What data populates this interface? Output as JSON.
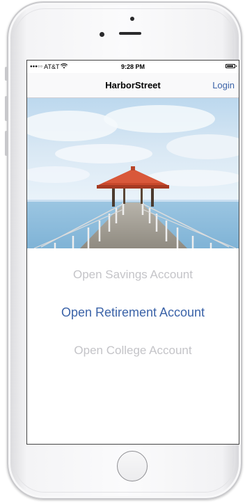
{
  "status_bar": {
    "signal": "●●●○○",
    "carrier": "AT&T",
    "time": "9:28 PM"
  },
  "nav": {
    "title": "HarborStreet",
    "login_label": "Login"
  },
  "options": {
    "savings_label": "Open Savings Account",
    "retirement_label": "Open Retirement Account",
    "college_label": "Open College Account"
  },
  "colors": {
    "accent": "#3b63a8",
    "inactive_option": "#c4c4c8"
  },
  "icons": {
    "wifi": "wifi-icon",
    "battery": "battery-icon",
    "home": "home-button-icon"
  }
}
